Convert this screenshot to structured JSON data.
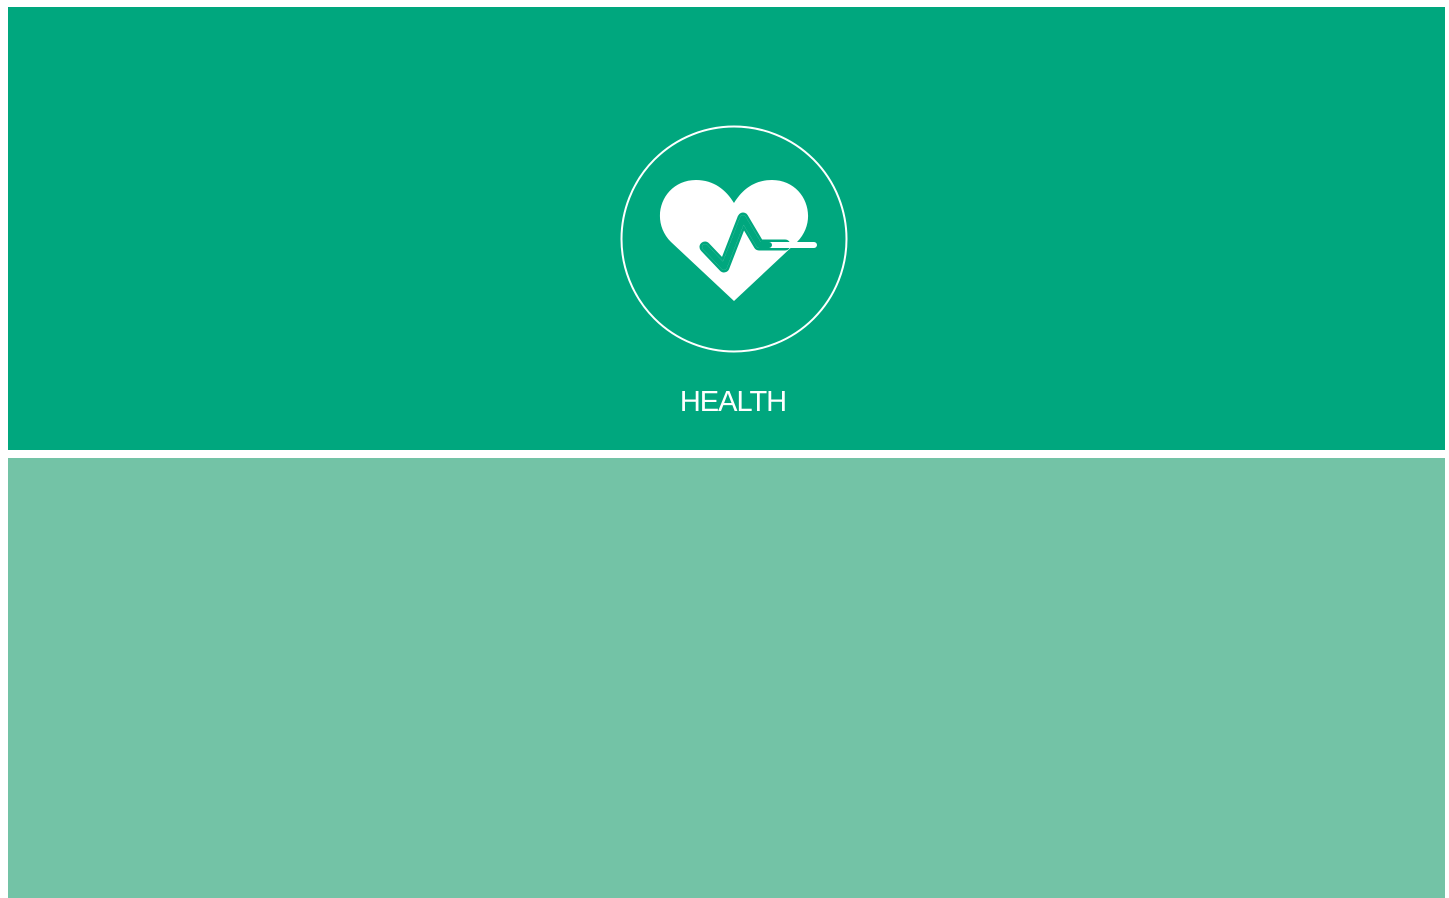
{
  "tiles": {
    "health": {
      "label": "HEALTH",
      "icon": "heart-pulse-icon"
    }
  },
  "colors": {
    "top_panel": "#00a77e",
    "bottom_panel": "#73c3a6",
    "icon": "#ffffff",
    "background": "#ffffff"
  }
}
